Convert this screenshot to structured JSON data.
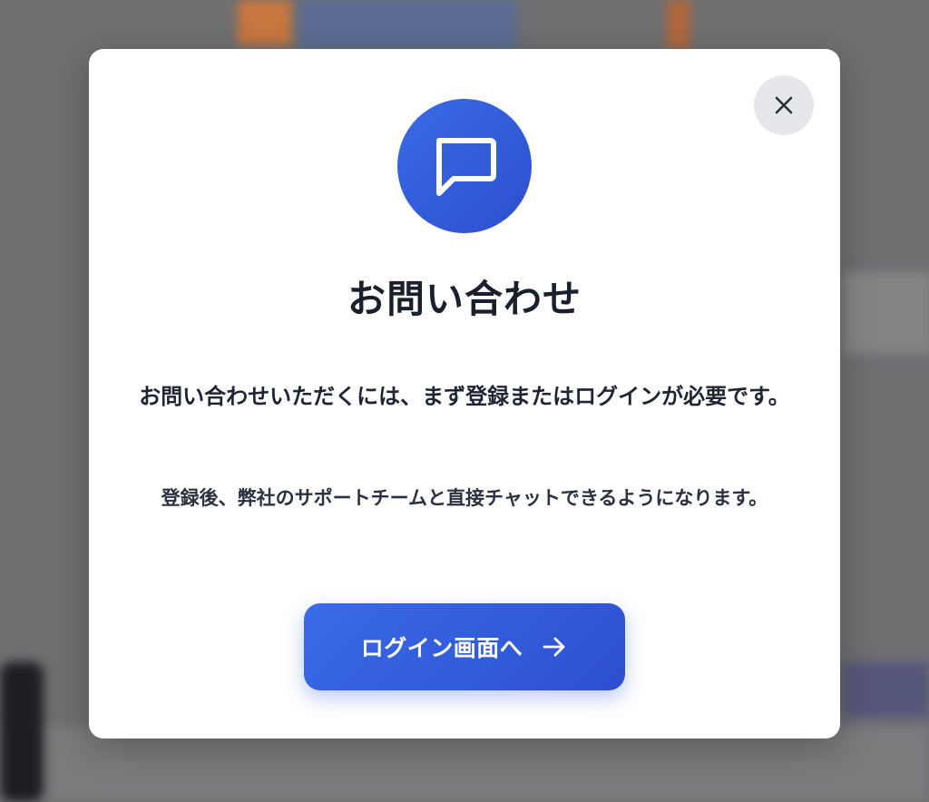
{
  "modal": {
    "title": "お問い合わせ",
    "message_primary": "お問い合わせいただくには、まず登録またはログインが必要です。",
    "message_secondary": "登録後、弊社のサポートチームと直接チャットできるようになります。",
    "login_button_label": "ログイン画面へ",
    "icons": {
      "header": "chat-bubble-icon",
      "close": "close-icon",
      "button": "arrow-right-icon"
    }
  },
  "colors": {
    "accent": "#3160DD",
    "title_text": "#1A1F2C",
    "close_bg": "#E6E7EA",
    "overlay": "#6F6F72"
  }
}
